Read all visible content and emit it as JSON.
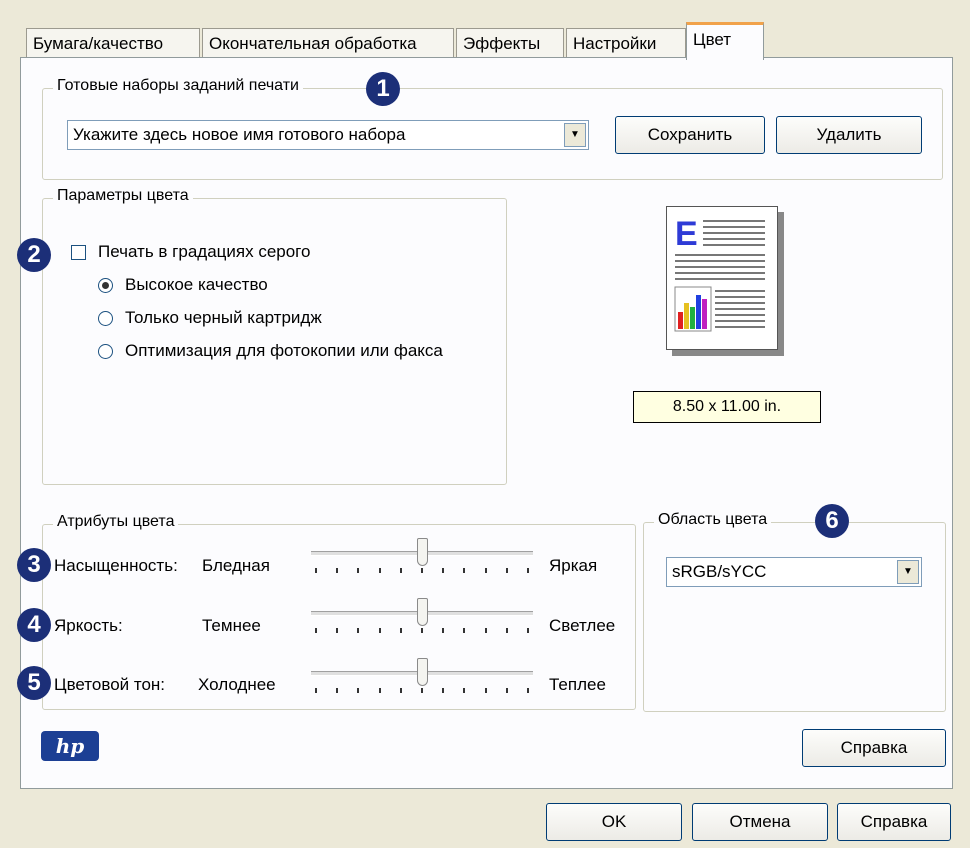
{
  "tabs": [
    {
      "label": "Бумага/качество",
      "active": false
    },
    {
      "label": "Окончательная обработка",
      "active": false
    },
    {
      "label": "Эффекты",
      "active": false
    },
    {
      "label": "Настройки",
      "active": false
    },
    {
      "label": "Цвет",
      "active": true
    }
  ],
  "presets": {
    "legend": "Готовые наборы заданий печати",
    "badge": "1",
    "combo_value": "Укажите здесь новое имя готового набора",
    "save_label": "Сохранить",
    "delete_label": "Удалить"
  },
  "color_params": {
    "legend": "Параметры цвета",
    "badge": "2",
    "grayscale_label": "Печать в градациях серого",
    "grayscale_checked": false,
    "options": [
      {
        "label": "Высокое качество",
        "selected": true
      },
      {
        "label": "Только черный картридж",
        "selected": false
      },
      {
        "label": "Оптимизация для фотокопии или факса",
        "selected": false
      }
    ]
  },
  "preview": {
    "paper_size": "8.50 x 11.00 in.",
    "preview_letter": "E"
  },
  "color_attrs": {
    "legend": "Атрибуты цвета",
    "rows": [
      {
        "badge": "3",
        "name": "Насыщенность:",
        "low": "Бледная",
        "high": "Яркая",
        "value": 0.5
      },
      {
        "badge": "4",
        "name": "Яркость:",
        "low": "Темнее",
        "high": "Светлее",
        "value": 0.5
      },
      {
        "badge": "5",
        "name": "Цветовой тон:",
        "low": "Холоднее",
        "high": "Теплее",
        "value": 0.5
      }
    ]
  },
  "color_space": {
    "legend": "Область цвета",
    "badge": "6",
    "value": "sRGB/sYCC"
  },
  "panel_help_label": "Справка",
  "footer": {
    "ok_label": "OK",
    "cancel_label": "Отмена",
    "help_label": "Справка"
  },
  "logo_text": "hp",
  "colors": {
    "badge": "#1c2f78",
    "active_tab_accent": "#f1a24a",
    "tooltip_bg": "#ffffe1"
  }
}
